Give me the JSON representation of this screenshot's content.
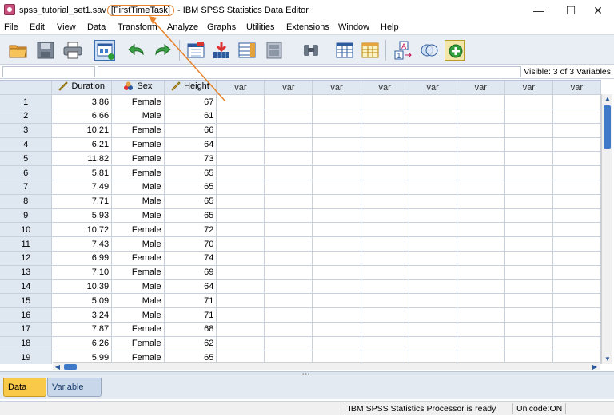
{
  "title": {
    "file": "spss_tutorial_set1.sav",
    "dataset": "[FirstTimeTask]",
    "app": " - IBM SPSS Statistics Data Editor"
  },
  "window_controls": {
    "minimize": "—",
    "maximize": "☐",
    "close": "✕"
  },
  "menu": [
    "File",
    "Edit",
    "View",
    "Data",
    "Transform",
    "Analyze",
    "Graphs",
    "Utilities",
    "Extensions",
    "Window",
    "Help"
  ],
  "toolbar_icons": [
    "open-folder-icon",
    "save-icon",
    "print-icon",
    "dialog-recall-icon",
    "undo-icon",
    "redo-icon",
    "go-to-case-icon",
    "go-to-variable-icon",
    "variables-icon",
    "find-icon",
    "insert-cases-icon",
    "insert-variable-icon",
    "split-file-icon",
    "weight-cases-icon",
    "value-labels-icon",
    "use-variable-sets-icon",
    "spelling-icon"
  ],
  "visible_label": "Visible: 3 of 3 Variables",
  "columns": {
    "duration": "Duration",
    "sex": "Sex",
    "height": "Height",
    "var": "var"
  },
  "rows": [
    {
      "n": "1",
      "duration": "3.86",
      "sex": "Female",
      "height": "67"
    },
    {
      "n": "2",
      "duration": "6.66",
      "sex": "Male",
      "height": "61"
    },
    {
      "n": "3",
      "duration": "10.21",
      "sex": "Female",
      "height": "66"
    },
    {
      "n": "4",
      "duration": "6.21",
      "sex": "Female",
      "height": "64"
    },
    {
      "n": "5",
      "duration": "11.82",
      "sex": "Female",
      "height": "73"
    },
    {
      "n": "6",
      "duration": "5.81",
      "sex": "Female",
      "height": "65"
    },
    {
      "n": "7",
      "duration": "7.49",
      "sex": "Male",
      "height": "65"
    },
    {
      "n": "8",
      "duration": "7.71",
      "sex": "Male",
      "height": "65"
    },
    {
      "n": "9",
      "duration": "5.93",
      "sex": "Male",
      "height": "65"
    },
    {
      "n": "10",
      "duration": "10.72",
      "sex": "Female",
      "height": "72"
    },
    {
      "n": "11",
      "duration": "7.43",
      "sex": "Male",
      "height": "70"
    },
    {
      "n": "12",
      "duration": "6.99",
      "sex": "Female",
      "height": "74"
    },
    {
      "n": "13",
      "duration": "7.10",
      "sex": "Female",
      "height": "69"
    },
    {
      "n": "14",
      "duration": "10.39",
      "sex": "Male",
      "height": "64"
    },
    {
      "n": "15",
      "duration": "5.09",
      "sex": "Male",
      "height": "71"
    },
    {
      "n": "16",
      "duration": "3.24",
      "sex": "Male",
      "height": "71"
    },
    {
      "n": "17",
      "duration": "7.87",
      "sex": "Female",
      "height": "68"
    },
    {
      "n": "18",
      "duration": "6.26",
      "sex": "Female",
      "height": "62"
    },
    {
      "n": "19",
      "duration": "5.99",
      "sex": "Female",
      "height": "65"
    }
  ],
  "tabs": {
    "data_view": "Data View",
    "variable_view": "Variable View"
  },
  "status": {
    "processor": "IBM SPSS Statistics Processor is ready",
    "unicode": "Unicode:ON"
  },
  "colors": {
    "accent": "#e8822b",
    "active_tab": "#f9c94a",
    "header_bg": "#dfe7f1",
    "scroll_thumb": "#3f79c8"
  }
}
